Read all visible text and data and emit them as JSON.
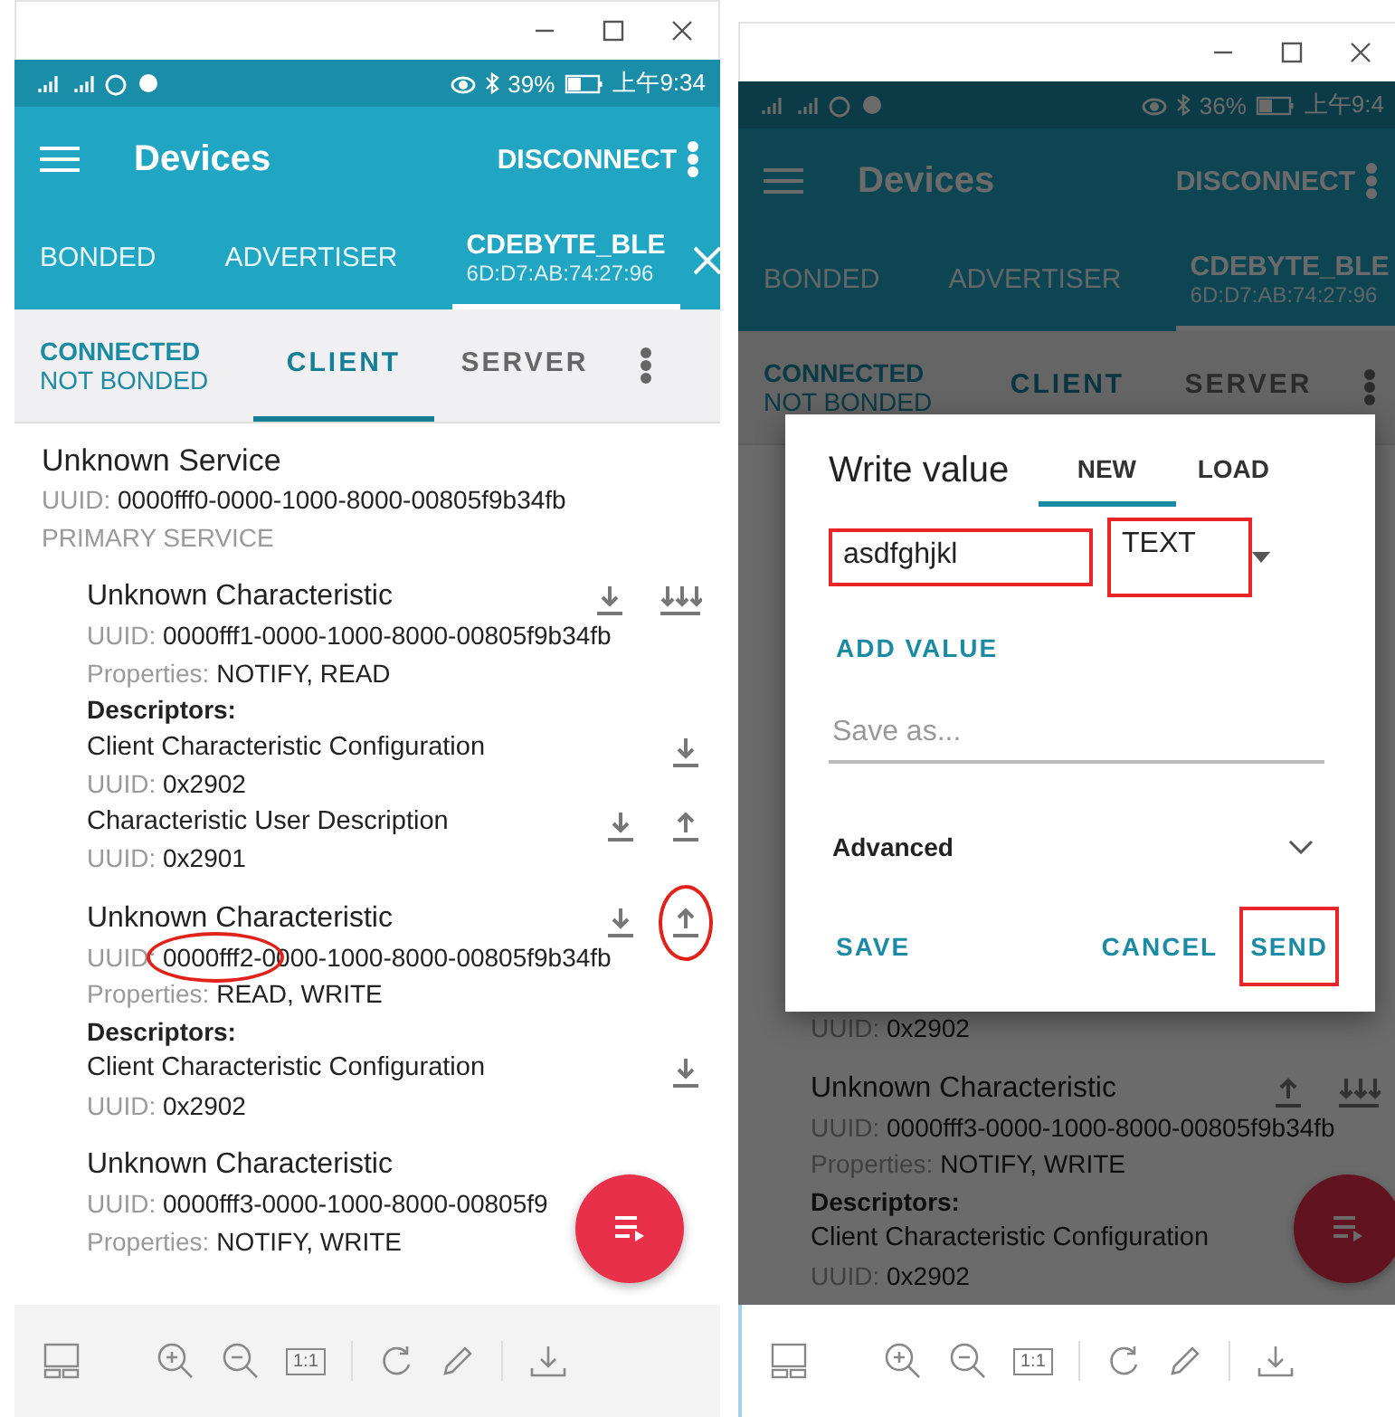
{
  "panels": [
    {
      "status": {
        "battery": "39%",
        "time": "上午9:34"
      },
      "app_bar": {
        "title": "Devices",
        "action": "DISCONNECT"
      },
      "device_tabs": [
        {
          "label": "BONDED",
          "selected": false
        },
        {
          "label": "ADVERTISER",
          "selected": false
        },
        {
          "label": "CDEBYTE_BLE",
          "address": "6D:D7:AB:74:27:96",
          "selected": true
        }
      ],
      "connection": {
        "state": "CONNECTED",
        "bond": "NOT BONDED"
      },
      "role_tabs": [
        {
          "label": "CLIENT",
          "selected": true
        },
        {
          "label": "SERVER",
          "selected": false
        }
      ],
      "content": [
        {
          "kind": "service",
          "name": "Unknown Service",
          "uuid_label": "UUID:",
          "uuid": "0000fff0-0000-1000-8000-00805f9b34fb",
          "type": "PRIMARY SERVICE"
        },
        {
          "kind": "characteristic",
          "name": "Unknown Characteristic",
          "uuid_label": "UUID:",
          "uuid": "0000fff1-0000-1000-8000-00805f9b34fb",
          "uuid_circled": false,
          "properties_label": "Properties:",
          "properties": "NOTIFY, READ",
          "actions": [
            {
              "kind": "read",
              "circled": false
            },
            {
              "kind": "notify",
              "circled": false
            }
          ]
        },
        {
          "kind": "heading",
          "text": "Descriptors:"
        },
        {
          "kind": "descriptor",
          "name": "Client Characteristic Configuration",
          "uuid_label": "UUID:",
          "uuid": "0x2902",
          "actions": [
            {
              "kind": "read",
              "circled": false
            }
          ]
        },
        {
          "kind": "descriptor",
          "name": "Characteristic User Description",
          "uuid_label": "UUID:",
          "uuid": "0x2901",
          "actions": [
            {
              "kind": "read",
              "circled": false
            },
            {
              "kind": "write",
              "circled": false
            }
          ]
        },
        {
          "kind": "characteristic",
          "name": "Unknown Characteristic",
          "uuid_label": "UUID:",
          "uuid": "0000fff2-0000-1000-8000-00805f9b34fb",
          "uuid_circled": true,
          "properties_label": "Properties:",
          "properties": "READ, WRITE",
          "actions": [
            {
              "kind": "read",
              "circled": false
            },
            {
              "kind": "write",
              "circled": true
            }
          ]
        },
        {
          "kind": "heading",
          "text": "Descriptors:"
        },
        {
          "kind": "descriptor",
          "name": "Client Characteristic Configuration",
          "uuid_label": "UUID:",
          "uuid": "0x2902",
          "actions": [
            {
              "kind": "read",
              "circled": false
            }
          ]
        },
        {
          "kind": "characteristic",
          "name": "Unknown Characteristic",
          "uuid_label": "UUID:",
          "uuid": "0000fff3-0000-1000-8000-00805f9",
          "uuid_circled": false,
          "properties_label": "Properties:",
          "properties": "NOTIFY, WRITE"
        }
      ],
      "dimmed": false,
      "toolbar": {
        "actual_size": "1:1"
      }
    },
    {
      "status": {
        "battery": "36%",
        "time": "上午9:4"
      },
      "app_bar": {
        "title": "Devices",
        "action": "DISCONNECT"
      },
      "device_tabs": [
        {
          "label": "BONDED",
          "selected": false
        },
        {
          "label": "ADVERTISER",
          "selected": false
        },
        {
          "label": "CDEBYTE_BLE",
          "address": "6D:D7:AB:74:27:96",
          "selected": true
        }
      ],
      "connection": {
        "state": "CONNECTED",
        "bond": "NOT BONDED"
      },
      "role_tabs": [
        {
          "label": "CLIENT",
          "selected": true
        },
        {
          "label": "SERVER",
          "selected": false
        }
      ],
      "content": [
        {
          "kind": "descriptor",
          "uuid_label": "UUID:",
          "uuid": "0x2902"
        },
        {
          "kind": "characteristic",
          "name": "Unknown Characteristic",
          "uuid_label": "UUID:",
          "uuid": "0000fff3-0000-1000-8000-00805f9b34fb",
          "uuid_circled": false,
          "properties_label": "Properties:",
          "properties": "NOTIFY, WRITE",
          "actions": [
            {
              "kind": "write",
              "circled": false
            },
            {
              "kind": "notify",
              "circled": false
            }
          ]
        },
        {
          "kind": "heading",
          "text": "Descriptors:"
        },
        {
          "kind": "descriptor",
          "name": "Client Characteristic Configuration",
          "uuid_label": "UUID:",
          "uuid": "0x2902"
        }
      ],
      "dimmed": true,
      "dialog": {
        "title": "Write value",
        "tabs": [
          {
            "label": "NEW",
            "selected": true
          },
          {
            "label": "LOAD",
            "selected": false
          }
        ],
        "value": "asdfghjkl",
        "value_boxed": true,
        "format": "TEXT",
        "format_boxed": true,
        "add_value": "ADD VALUE",
        "save_as_placeholder": "Save as...",
        "advanced": {
          "label": "Advanced",
          "expanded": false
        },
        "buttons": [
          {
            "label": "SAVE",
            "boxed": false
          },
          {
            "label": "CANCEL",
            "boxed": false
          },
          {
            "label": "SEND",
            "boxed": true
          }
        ]
      },
      "toolbar": {
        "actual_size": "1:1"
      }
    }
  ]
}
